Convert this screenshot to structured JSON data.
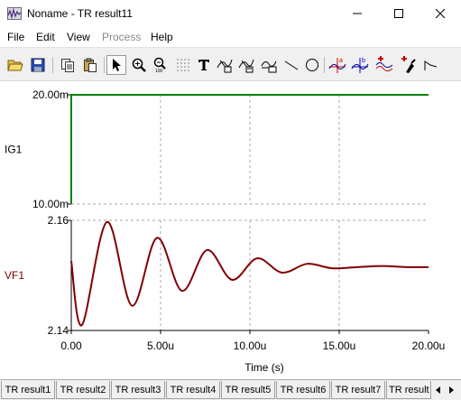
{
  "window": {
    "title": "Noname - TR result11",
    "app_icon": "oscilloscope-app-icon",
    "controls": [
      "minimize-icon",
      "maximize-icon",
      "close-icon"
    ]
  },
  "menu": [
    {
      "label": "File",
      "enabled": true
    },
    {
      "label": "Edit",
      "enabled": true
    },
    {
      "label": "View",
      "enabled": true
    },
    {
      "label": "Process",
      "enabled": false
    },
    {
      "label": "Help",
      "enabled": true
    }
  ],
  "toolbar": [
    {
      "icon": "open-folder-icon"
    },
    {
      "icon": "save-disk-icon"
    },
    {
      "icon": "copy-icon"
    },
    {
      "icon": "paste-icon"
    },
    {
      "icon": "select-arrow-icon",
      "pressed": true
    },
    {
      "icon": "zoom-in-icon"
    },
    {
      "icon": "zoom-100-icon"
    },
    {
      "icon": "grid-dots-icon"
    },
    {
      "icon": "text-tool-icon"
    },
    {
      "icon": "curve-label-icon"
    },
    {
      "icon": "curve-label-2-icon"
    },
    {
      "icon": "axis-label-icon"
    },
    {
      "icon": "line-tool-icon"
    },
    {
      "icon": "circle-tool-icon"
    },
    {
      "icon": "cursor-a-icon"
    },
    {
      "icon": "cursor-b-icon"
    },
    {
      "icon": "add-curve-icon"
    },
    {
      "icon": "add-marker-icon"
    },
    {
      "icon": "pen-icon"
    }
  ],
  "chart_data": [
    {
      "type": "line",
      "ylabel": "IG1",
      "ylim": [
        0.01,
        0.02
      ],
      "yticks": [
        "20.00m",
        "10.00m"
      ],
      "xlim": [
        0,
        20
      ],
      "x_unit": "u",
      "grid": true,
      "color": "#008000",
      "series": [
        {
          "x": [
            0,
            0,
            20
          ],
          "y": [
            0.01,
            0.02,
            0.02
          ]
        }
      ]
    },
    {
      "type": "line",
      "ylabel": "VF1",
      "ylim": [
        2.14,
        2.16
      ],
      "yticks": [
        "2.16",
        "2.14"
      ],
      "xlim": [
        0,
        20
      ],
      "xticks": [
        {
          "value": 0,
          "label": "0.00"
        },
        {
          "value": 5,
          "label": "5.00u"
        },
        {
          "value": 10,
          "label": "10.00u"
        },
        {
          "value": 15,
          "label": "15.00u"
        },
        {
          "value": 20,
          "label": "20.00u"
        }
      ],
      "xlabel": "Time (s)",
      "grid": true,
      "color": "#800000",
      "series": [
        {
          "x": [
            0,
            0.6,
            2.0,
            3.4,
            4.8,
            6.2,
            7.6,
            9.0,
            10.4,
            11.8,
            13.2,
            14.6,
            16.0,
            17.4,
            18.8,
            20.0
          ],
          "y": [
            2.1526,
            2.141,
            2.1597,
            2.1445,
            2.1568,
            2.1472,
            2.1546,
            2.1492,
            2.1531,
            2.1505,
            2.1521,
            2.1513,
            2.1515,
            2.1517,
            2.1515,
            2.1515
          ]
        }
      ]
    }
  ],
  "tabs": [
    {
      "label": "TR result1",
      "active": false
    },
    {
      "label": "TR result2",
      "active": false
    },
    {
      "label": "TR result3",
      "active": false
    },
    {
      "label": "TR result4",
      "active": false
    },
    {
      "label": "TR result5",
      "active": false
    },
    {
      "label": "TR result6",
      "active": false
    },
    {
      "label": "TR result7",
      "active": false
    },
    {
      "label": "TR result",
      "active": false
    }
  ],
  "tab_nav": [
    "tab-scroll-left-icon",
    "tab-scroll-right-icon"
  ]
}
